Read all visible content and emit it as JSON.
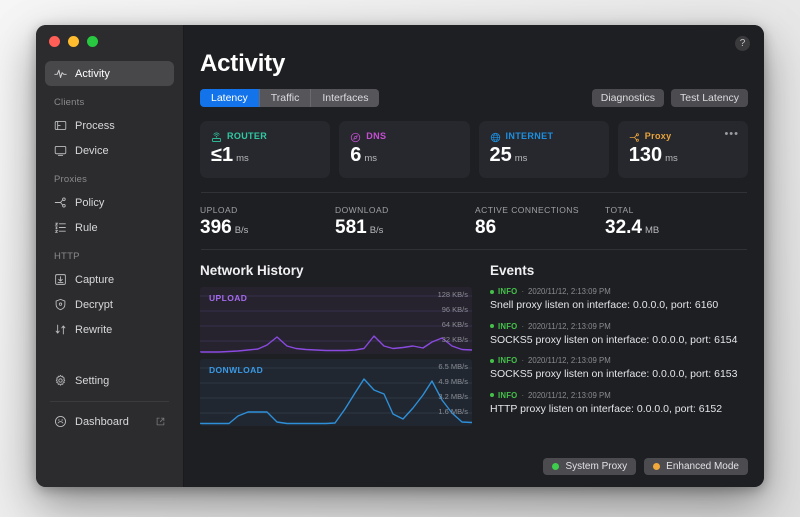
{
  "window": {
    "traffic_lights": [
      "close",
      "minimize",
      "zoom"
    ],
    "help_glyph": "?"
  },
  "sidebar": {
    "items": [
      {
        "label": "Activity",
        "icon": "activity-pulse-icon",
        "active": true
      },
      {
        "group": "Clients"
      },
      {
        "label": "Process",
        "icon": "process-window-icon",
        "active": false
      },
      {
        "label": "Device",
        "icon": "device-monitor-icon",
        "active": false
      },
      {
        "group": "Proxies"
      },
      {
        "label": "Policy",
        "icon": "policy-node-icon",
        "active": false
      },
      {
        "label": "Rule",
        "icon": "rule-list-icon",
        "active": false
      },
      {
        "group": "HTTP"
      },
      {
        "label": "Capture",
        "icon": "capture-download-icon",
        "active": false
      },
      {
        "label": "Decrypt",
        "icon": "decrypt-shield-icon",
        "active": false
      },
      {
        "label": "Rewrite",
        "icon": "rewrite-arrows-icon",
        "active": false
      },
      {
        "label": "Setting",
        "icon": "gear-icon",
        "active": false
      },
      {
        "label": "Dashboard",
        "icon": "dashboard-face-icon",
        "active": false,
        "external": true
      }
    ],
    "groups": {
      "clients": "Clients",
      "proxies": "Proxies",
      "http": "HTTP"
    }
  },
  "header": {
    "title": "Activity",
    "tabs": [
      {
        "label": "Latency",
        "active": true
      },
      {
        "label": "Traffic",
        "active": false
      },
      {
        "label": "Interfaces",
        "active": false
      }
    ],
    "buttons": [
      {
        "label": "Diagnostics"
      },
      {
        "label": "Test Latency"
      }
    ]
  },
  "cards": [
    {
      "title": "ROUTER",
      "value": "≤1",
      "unit": "ms",
      "color": "#30c9a4",
      "icon": "router-icon"
    },
    {
      "title": "DNS",
      "value": "6",
      "unit": "ms",
      "color": "#c54ed4",
      "icon": "dns-compass-icon"
    },
    {
      "title": "INTERNET",
      "value": "25",
      "unit": "ms",
      "color": "#1d8fe0",
      "icon": "globe-icon"
    },
    {
      "title": "Proxy",
      "value": "130",
      "unit": "ms",
      "color": "#e8a33d",
      "icon": "proxy-node-icon",
      "more": "•••"
    }
  ],
  "metrics": [
    {
      "label": "UPLOAD",
      "value": "396",
      "unit": "B/s"
    },
    {
      "label": "DOWNLOAD",
      "value": "581",
      "unit": "B/s"
    },
    {
      "label": "ACTIVE CONNECTIONS",
      "value": "86",
      "unit": ""
    },
    {
      "label": "TOTAL",
      "value": "32.4",
      "unit": "MB"
    }
  ],
  "network_history": {
    "title": "Network History",
    "upload": {
      "label": "UPLOAD",
      "color": "#8a4ae0",
      "ticks": [
        "128 KB/s",
        "96 KB/s",
        "64 KB/s",
        "32 KB/s"
      ]
    },
    "download": {
      "label": "DONWLOAD",
      "color": "#2e8fd8",
      "ticks": [
        "6.5 MB/s",
        "4.9 MB/s",
        "3.2 MB/s",
        "1.6 MB/s"
      ]
    }
  },
  "chart_data": [
    {
      "type": "area",
      "title": "UPLOAD",
      "ylabel": "KB/s",
      "ylim": [
        0,
        160
      ],
      "yticks": [
        128,
        96,
        64,
        32
      ],
      "grid": true,
      "legend": "none",
      "color": "#8a4ae0",
      "x": [
        0,
        1,
        2,
        3,
        4,
        5,
        6,
        7,
        8,
        9,
        10,
        11,
        12,
        13,
        14,
        15,
        16,
        17,
        18,
        19,
        20,
        21,
        22,
        23,
        24,
        25,
        26,
        27,
        28
      ],
      "values": [
        3,
        3,
        3,
        3,
        4,
        5,
        7,
        12,
        26,
        14,
        9,
        7,
        6,
        5,
        5,
        5,
        6,
        8,
        28,
        14,
        9,
        11,
        13,
        10,
        22,
        30,
        14,
        7,
        6
      ]
    },
    {
      "type": "area",
      "title": "DONWLOAD",
      "ylabel": "MB/s",
      "ylim": [
        0,
        8.1
      ],
      "yticks": [
        6.5,
        4.9,
        3.2,
        1.6
      ],
      "grid": true,
      "legend": "none",
      "color": "#2e8fd8",
      "x": [
        0,
        1,
        2,
        3,
        4,
        5,
        6,
        7,
        8,
        9,
        10,
        11,
        12,
        13,
        14,
        15,
        16,
        17,
        18,
        19,
        20,
        21,
        22,
        23,
        24,
        25,
        26,
        27,
        28
      ],
      "values": [
        0.15,
        0.15,
        0.15,
        0.15,
        0.9,
        1.3,
        1.3,
        1.3,
        0.25,
        0.15,
        0.15,
        0.15,
        0.15,
        0.15,
        0.2,
        1.6,
        3.4,
        5.1,
        3.9,
        3.5,
        1.1,
        0.5,
        1.6,
        3.2,
        5.0,
        2.8,
        1.2,
        0.35,
        0.3
      ]
    }
  ],
  "events": {
    "title": "Events",
    "items": [
      {
        "level": "INFO",
        "sep": "·",
        "time": "2020/11/12, 2:13:09 PM",
        "message": "Snell proxy listen on interface: 0.0.0.0, port: 6160"
      },
      {
        "level": "INFO",
        "sep": "·",
        "time": "2020/11/12, 2:13:09 PM",
        "message": "SOCKS5 proxy listen on interface: 0.0.0.0, port: 6154"
      },
      {
        "level": "INFO",
        "sep": "·",
        "time": "2020/11/12, 2:13:09 PM",
        "message": "SOCKS5 proxy listen on interface: 0.0.0.0, port: 6153"
      },
      {
        "level": "INFO",
        "sep": "·",
        "time": "2020/11/12, 2:13:09 PM",
        "message": "HTTP proxy listen on interface: 0.0.0.0, port: 6152"
      }
    ]
  },
  "status_bar": [
    {
      "label": "System Proxy",
      "color": "#3ece4e"
    },
    {
      "label": "Enhanced Mode",
      "color": "#f2a93b"
    }
  ]
}
